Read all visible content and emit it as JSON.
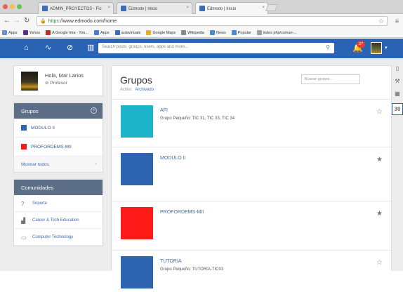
{
  "browser": {
    "tabs": [
      {
        "label": "ADMIN_PROYECTOS - Fic",
        "active": false
      },
      {
        "label": "Edmodo | Inicio",
        "active": false
      },
      {
        "label": "Edmodo | Inicio",
        "active": true
      }
    ],
    "url_scheme": "https",
    "url_rest": "://www.edmodo.com/home",
    "bookmarks": [
      {
        "label": "Apps",
        "color": "#6d8fd0"
      },
      {
        "label": "Yahoo",
        "color": "#5b2d91"
      },
      {
        "label": "A Google Ima - You...",
        "color": "#c62828"
      },
      {
        "label": "Apps",
        "color": "#4a7bd3"
      },
      {
        "label": "aulavirtuals",
        "color": "#3a6fb8"
      },
      {
        "label": "Google Maps",
        "color": "#e8b21f"
      },
      {
        "label": "Wikipedia",
        "color": "#888888"
      },
      {
        "label": "News",
        "color": "#4b88d4"
      },
      {
        "label": "Popular",
        "color": "#4b88d4"
      },
      {
        "label": "index php/coman-...",
        "color": "#a0a0a0"
      }
    ]
  },
  "header": {
    "search_placeholder": "Search posts, groups, users, apps and more...",
    "notification_count": "27",
    "icons": [
      "home-icon",
      "activity-icon",
      "discover-icon",
      "library-icon"
    ]
  },
  "profile": {
    "greeting": "Hola, Mar Larios",
    "role": "Profesor"
  },
  "sidebar": {
    "groups_title": "Grupos",
    "groups": [
      {
        "label": "MODULO II",
        "color": "#2f64b0"
      },
      {
        "label": "PROFORDEMS-MII",
        "color": "#ff1a1a"
      }
    ],
    "show_all": "Mostrar todos",
    "communities_title": "Comunidades",
    "communities": [
      {
        "label": "Soporte",
        "icon": "help-icon"
      },
      {
        "label": "Career & Tech Education",
        "icon": "chart-icon"
      },
      {
        "label": "Computer Technology",
        "icon": "monitor-icon"
      }
    ]
  },
  "main": {
    "title": "Grupos",
    "filter_active": "Activo",
    "filter_archived": "Archivado",
    "search_placeholder": "Buscar grupos...",
    "groups": [
      {
        "name": "AFI",
        "sub": "Grupo Pequeño: TIC 31, TIC 33, TIC 34",
        "color": "#1cb4c8",
        "starred": false
      },
      {
        "name": "MODULO II",
        "sub": "",
        "color": "#2f64b0",
        "starred": true
      },
      {
        "name": "PROFORDEMS-MII",
        "sub": "",
        "color": "#ff1a1a",
        "starred": true
      },
      {
        "name": "TUTORIA",
        "sub": "Grupo Pequeño: TUTORIA-TIC03",
        "color": "#2f64b0",
        "starred": false
      }
    ]
  },
  "rail": {
    "calendar_day": "30"
  },
  "colors": {
    "brand": "#2a63b3",
    "sidebar_header": "#5d6f86"
  }
}
